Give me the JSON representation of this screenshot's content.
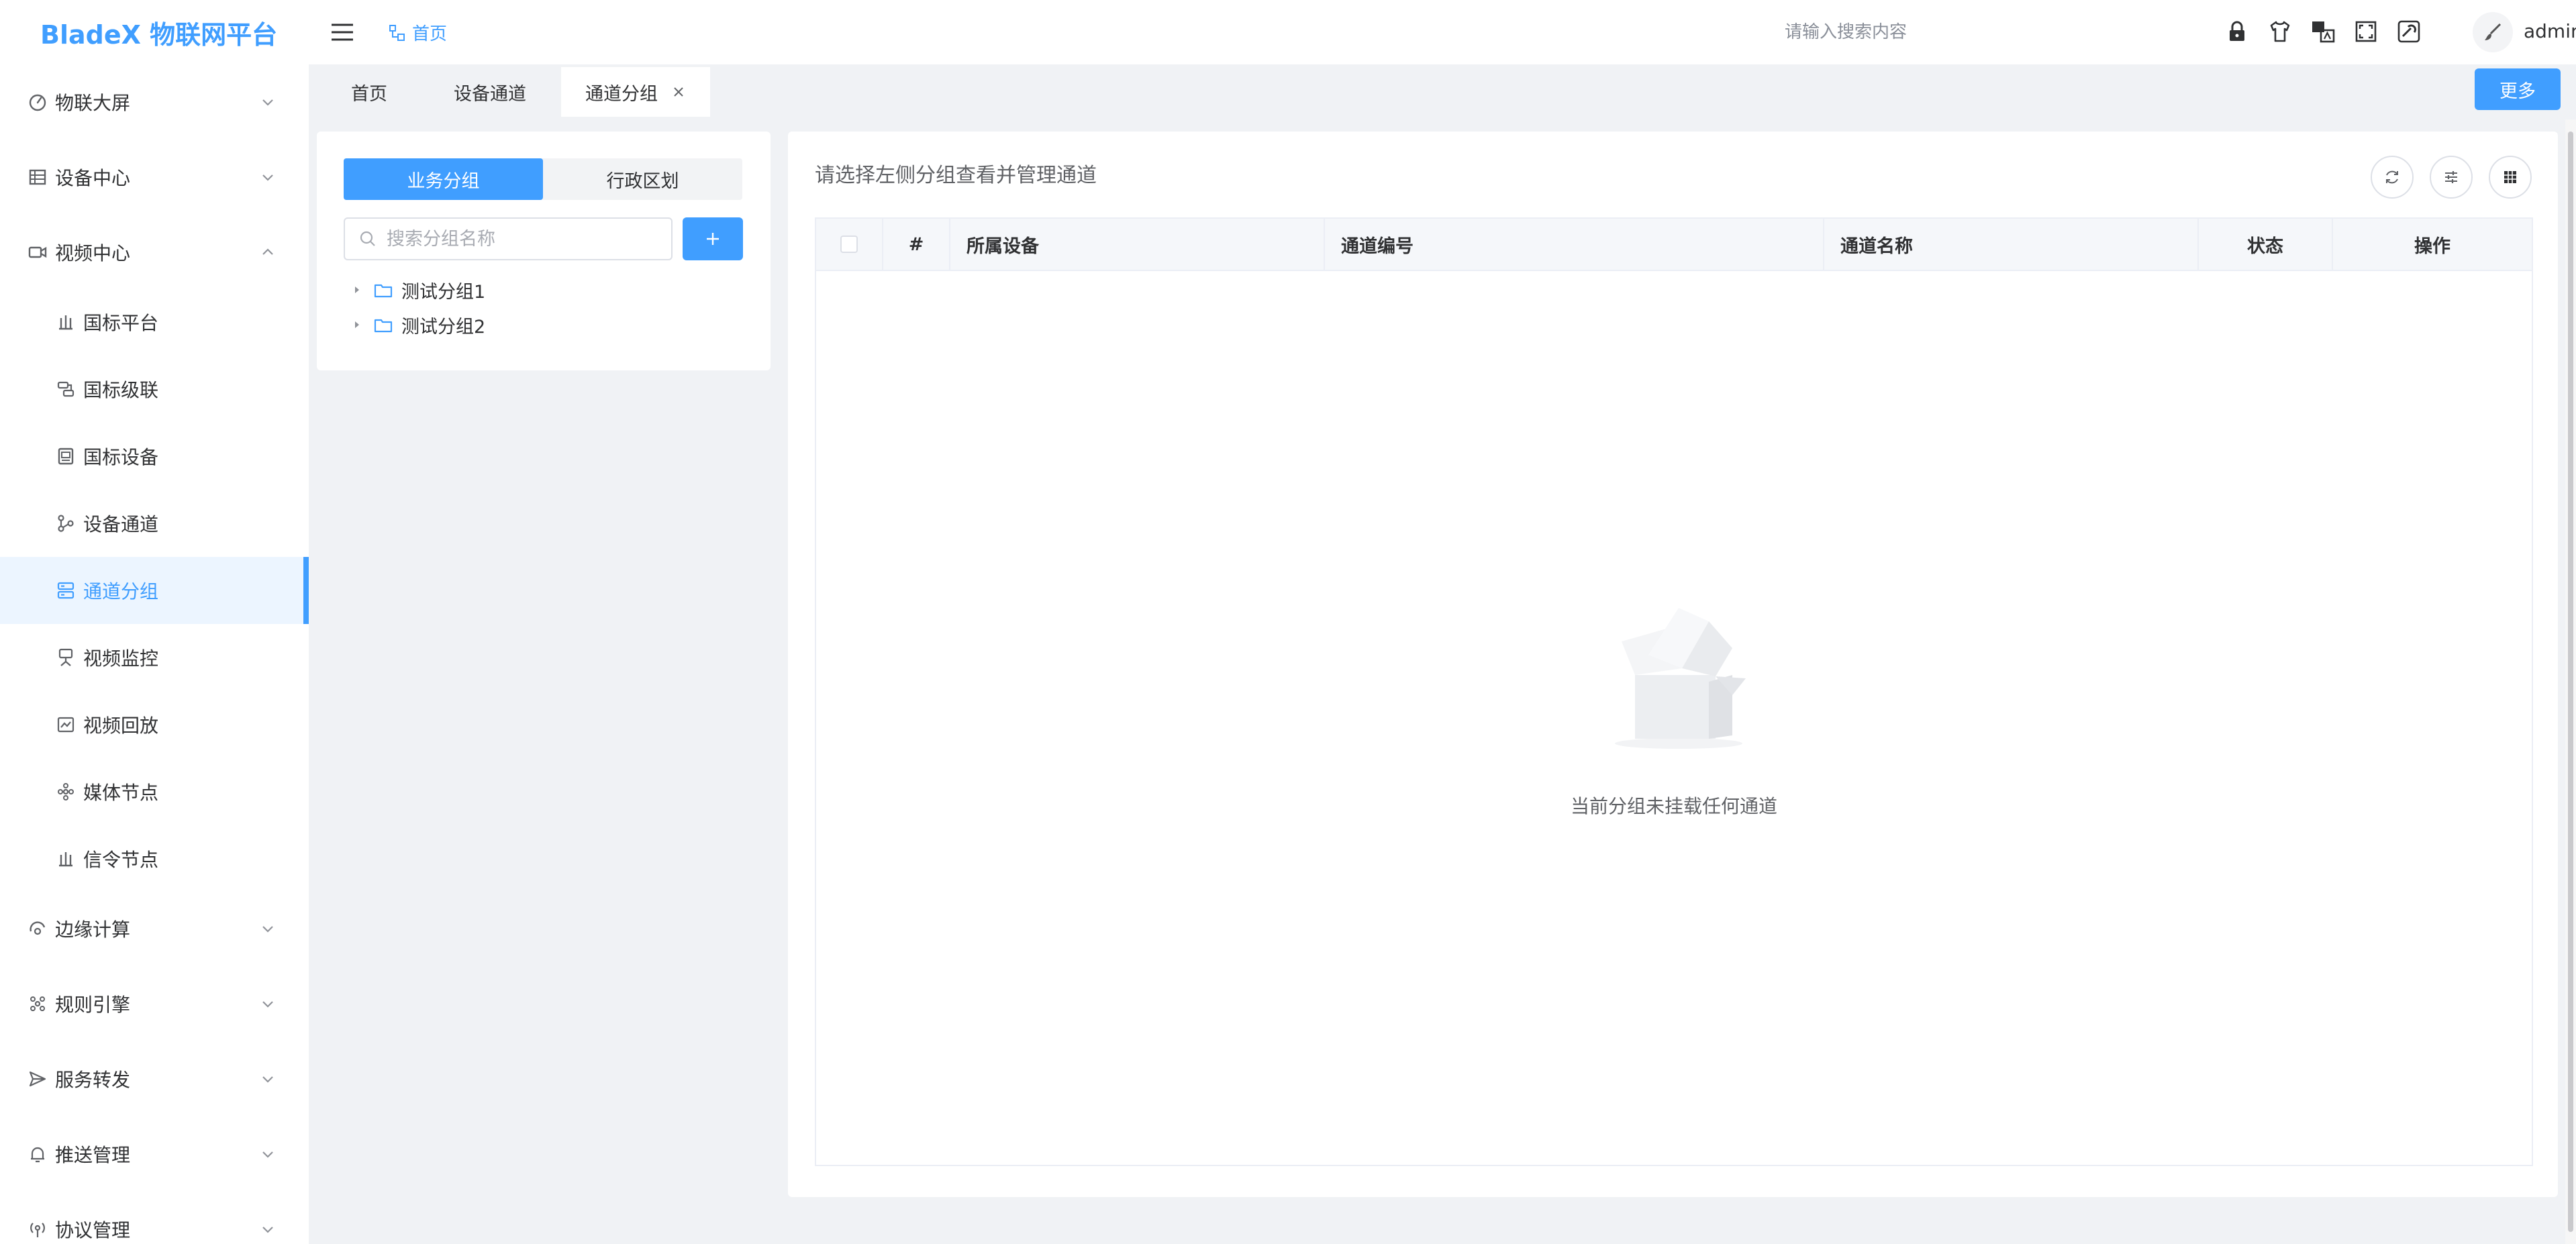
{
  "app": {
    "title": "BladeX 物联网平台"
  },
  "sidebar": {
    "items": [
      {
        "label": "物联大屏",
        "icon": "dashboard-icon",
        "expanded": false
      },
      {
        "label": "设备中心",
        "icon": "grid-icon",
        "expanded": false
      },
      {
        "label": "视频中心",
        "icon": "video-icon",
        "expanded": true
      },
      {
        "label": "国标平台",
        "icon": "platform-icon"
      },
      {
        "label": "国标级联",
        "icon": "cascade-icon"
      },
      {
        "label": "国标设备",
        "icon": "device-icon"
      },
      {
        "label": "设备通道",
        "icon": "channel-icon"
      },
      {
        "label": "通道分组",
        "icon": "group-icon",
        "active": true
      },
      {
        "label": "视频监控",
        "icon": "camera-icon"
      },
      {
        "label": "视频回放",
        "icon": "playback-icon"
      },
      {
        "label": "媒体节点",
        "icon": "media-node-icon"
      },
      {
        "label": "信令节点",
        "icon": "signal-node-icon"
      },
      {
        "label": "边缘计算",
        "icon": "edge-icon",
        "expanded": false
      },
      {
        "label": "规则引擎",
        "icon": "rule-icon",
        "expanded": false
      },
      {
        "label": "服务转发",
        "icon": "send-icon",
        "expanded": false
      },
      {
        "label": "推送管理",
        "icon": "bell-icon",
        "expanded": false
      },
      {
        "label": "协议管理",
        "icon": "protocol-icon",
        "expanded": false
      }
    ]
  },
  "header": {
    "breadcrumb": "首页",
    "search_placeholder": "请输入搜索内容",
    "icons": [
      "lock-icon",
      "theme-shirt-icon",
      "language-icon",
      "fullscreen-icon",
      "settings-icon"
    ],
    "user": "admin"
  },
  "tags": {
    "items": [
      {
        "label": "首页",
        "active": false
      },
      {
        "label": "设备通道",
        "active": false
      },
      {
        "label": "通道分组",
        "active": true,
        "closable": true
      }
    ],
    "more_label": "更多"
  },
  "left_panel": {
    "segments": [
      {
        "label": "业务分组",
        "active": true
      },
      {
        "label": "行政区划",
        "active": false
      }
    ],
    "search_placeholder": "搜索分组名称",
    "add_label": "+",
    "tree": [
      {
        "label": "测试分组1"
      },
      {
        "label": "测试分组2"
      }
    ]
  },
  "main": {
    "title": "请选择左侧分组查看并管理通道",
    "tools": [
      "refresh-icon",
      "filter-icon",
      "columns-icon"
    ],
    "columns": [
      "#",
      "所属设备",
      "通道编号",
      "通道名称",
      "状态",
      "操作"
    ],
    "empty_text": "当前分组未挂载任何通道"
  },
  "colors": {
    "accent": "#409eff",
    "active_bg": "#ecf5ff",
    "page_bg": "#f0f2f5"
  }
}
